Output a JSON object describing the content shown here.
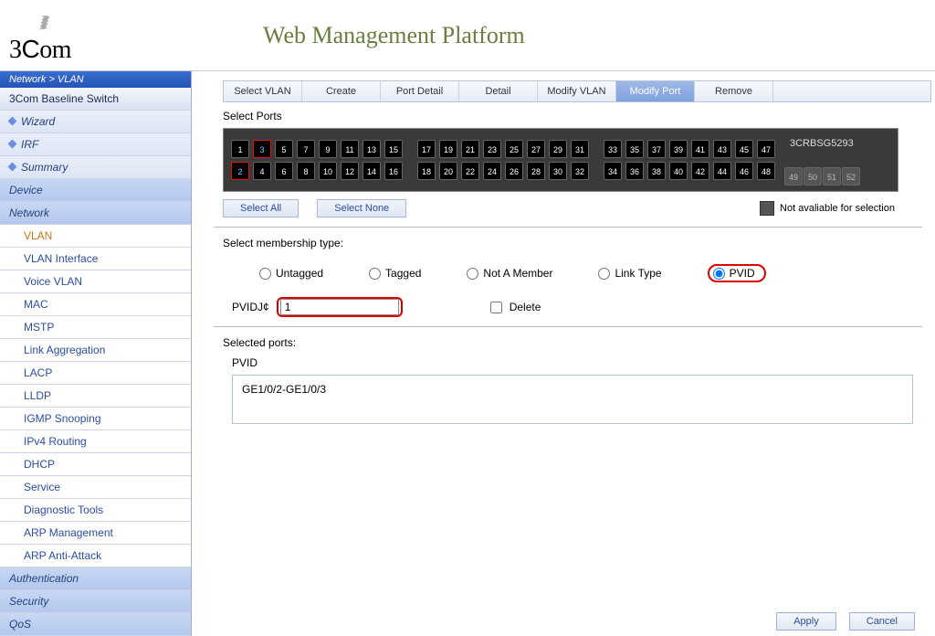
{
  "header": {
    "brand_combo": "3Com",
    "title": "Web Management Platform"
  },
  "breadcrumb": "Network > VLAN",
  "sidebar": {
    "root": "3Com Baseline Switch",
    "items": [
      {
        "type": "sub",
        "label": "Wizard",
        "diamond": true
      },
      {
        "type": "sub",
        "label": "IRF",
        "diamond": true
      },
      {
        "type": "sub",
        "label": "Summary",
        "diamond": true
      },
      {
        "type": "sub",
        "label": "Device",
        "hl": true
      },
      {
        "type": "sub",
        "label": "Network",
        "hl": true
      },
      {
        "type": "link",
        "label": "VLAN",
        "active": true
      },
      {
        "type": "link",
        "label": "VLAN Interface"
      },
      {
        "type": "link",
        "label": "Voice VLAN"
      },
      {
        "type": "link",
        "label": "MAC"
      },
      {
        "type": "link",
        "label": "MSTP"
      },
      {
        "type": "link",
        "label": "Link Aggregation"
      },
      {
        "type": "link",
        "label": "LACP"
      },
      {
        "type": "link",
        "label": "LLDP"
      },
      {
        "type": "link",
        "label": "IGMP Snooping"
      },
      {
        "type": "link",
        "label": "IPv4 Routing"
      },
      {
        "type": "link",
        "label": "DHCP"
      },
      {
        "type": "link",
        "label": "Service"
      },
      {
        "type": "link",
        "label": "Diagnostic Tools"
      },
      {
        "type": "link",
        "label": "ARP Management"
      },
      {
        "type": "link",
        "label": "ARP Anti-Attack"
      },
      {
        "type": "sub",
        "label": "Authentication",
        "hl": true
      },
      {
        "type": "sub",
        "label": "Security",
        "hl": true
      },
      {
        "type": "sub",
        "label": "QoS",
        "hl": true
      }
    ]
  },
  "tabs": [
    {
      "label": "Select VLAN"
    },
    {
      "label": "Create"
    },
    {
      "label": "Port Detail"
    },
    {
      "label": "Detail"
    },
    {
      "label": "Modify VLAN"
    },
    {
      "label": "Modify Port",
      "active": true
    },
    {
      "label": "Remove"
    }
  ],
  "sections": {
    "select_ports": "Select Ports",
    "membership": "Select membership type:",
    "selected_ports": "Selected ports:"
  },
  "switch_model": "3CRBSG5293",
  "switch_buttons": {
    "select_all": "Select All",
    "select_none": "Select None"
  },
  "legend_not_avail": "Not avaliable for selection",
  "membership_options": [
    "Untagged",
    "Tagged",
    "Not A Member",
    "Link Type",
    "PVID"
  ],
  "pvid_label": "PVIDJ¢",
  "pvid_value": "1",
  "delete_label": "Delete",
  "selected_ports_title": "PVID",
  "selected_ports_value": "GE1/0/2-GE1/0/3",
  "buttons": {
    "apply": "Apply",
    "cancel": "Cancel"
  },
  "selected_port_numbers": [
    2,
    3
  ],
  "disabled_port_numbers": [
    49,
    50,
    51,
    52
  ]
}
